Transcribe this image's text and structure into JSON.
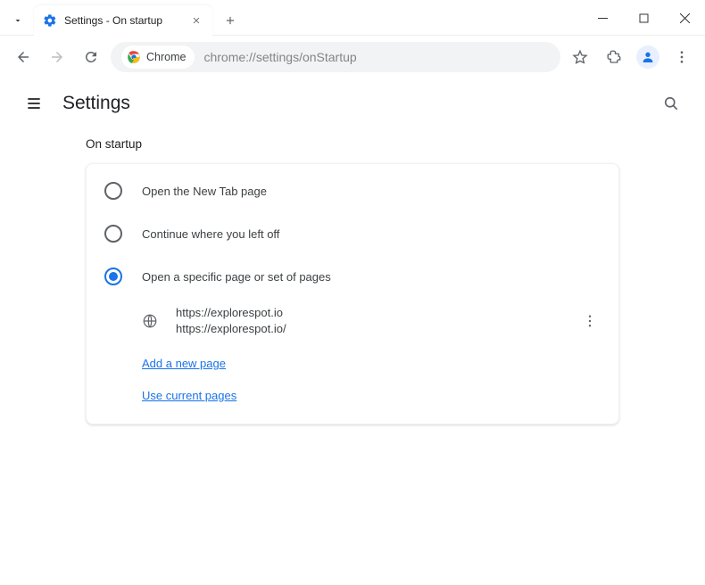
{
  "titlebar": {
    "tab_title": "Settings - On startup"
  },
  "addressbar": {
    "chip_label": "Chrome",
    "url": "chrome://settings/onStartup"
  },
  "header": {
    "title": "Settings"
  },
  "section": {
    "heading": "On startup",
    "options": [
      {
        "label": "Open the New Tab page",
        "checked": false
      },
      {
        "label": "Continue where you left off",
        "checked": false
      },
      {
        "label": "Open a specific page or set of pages",
        "checked": true
      }
    ],
    "page_entry": {
      "line1": "https://explorespot.io",
      "line2": "https://explorespot.io/"
    },
    "link_add": "Add a new page",
    "link_current": "Use current pages"
  }
}
